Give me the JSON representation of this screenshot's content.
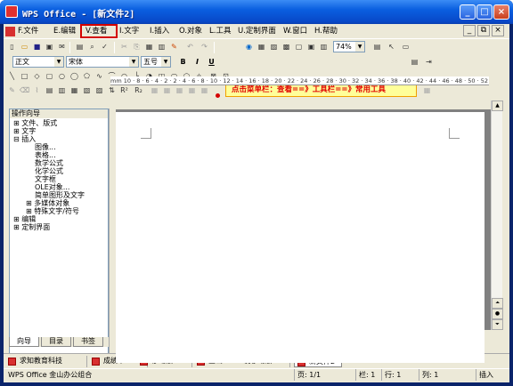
{
  "window": {
    "title": "WPS Office - [新文件2]"
  },
  "menu": {
    "items": [
      "F.文件",
      "E.编辑",
      "V.查看",
      "I.文字",
      "I.插入",
      "O.对象",
      "L.工具",
      "U.定制界面",
      "W.窗口",
      "H.帮助"
    ],
    "highlighted": "V.查看"
  },
  "toolbar": {
    "zoom": "74%",
    "style": "正文",
    "font": "宋体",
    "size": "五号",
    "bold": "B",
    "italic": "I",
    "underline": "U"
  },
  "tooltip": {
    "text": "点击菜单栏：查看==》工具栏==》常用工具"
  },
  "panel": {
    "title": "操作向导",
    "tree": [
      "文件、版式",
      "文字",
      "插入",
      "图像...",
      "表格...",
      "数学公式",
      "化学公式",
      "文字框",
      "OLE对象...",
      "简单图形及文字",
      "多媒体对象",
      "特殊文字/符号",
      "编辑",
      "定制界面"
    ],
    "tabs": [
      "向导",
      "目录",
      "书签"
    ]
  },
  "ruler": {
    "marks": "mm 10 · 8 · 6 · 4 · 2 · 2 · 4 · 6 · 8 · 10 · 12 · 14 · 16 · 18 · 20 · 22 · 24 · 26 · 28 · 30 · 32 · 34 · 36 · 38 · 40 · 42 · 44 · 46 · 48 · 50 · 52 · 54 · 56 · 58 · 60 · 62 · 64 · 66 · 68 · 70 · 72 · 74 · 76 · 78 · 80 · 82 · 84 · 86 · 88 · 90 · 92 · 94 · 96 · 98 · 100 · 102 · 104 · 106 · 108 · 110 · 112 · 114 · 116 · 118 · 120 · 122 · 124 · 126 · 128 · 130 · 132 · 134 · 136 · 138 · 140 · 142 · 144 · 146 · 148 · 150 · 152 · 154 · 156 · 158 · 160 · 162 · 164 · 166 · 168 · 170 · 172 · 174 · 176 · 178 · 180 · 182 · 184 · 186 · 188 · 190 · 192 · 194 · 196 · 198 · 200 · 202 · 204 · 206 · 208 · 210"
  },
  "doctabs": [
    {
      "label": "求知教育科技"
    },
    {
      "label": "成绩单"
    },
    {
      "label": "移动版 *"
    },
    {
      "label": "金山Office发移动版"
    },
    {
      "label": "新文件2"
    }
  ],
  "status": {
    "app": "WPS Office 金山办公组合",
    "page": "页: 1/1",
    "col": "栏: 1",
    "row": "行: 1",
    "pos": "列: 1",
    "mode": "插入"
  }
}
